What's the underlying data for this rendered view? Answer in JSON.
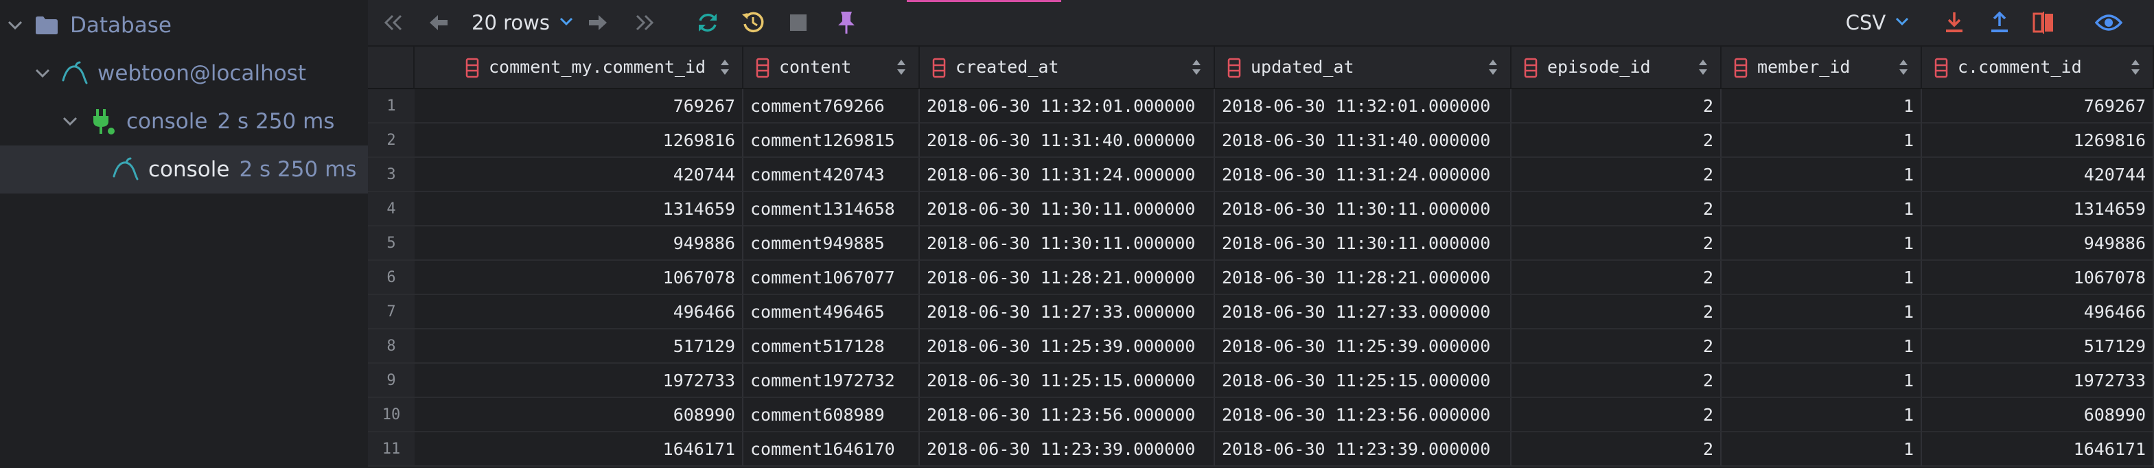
{
  "sidebar": {
    "items": [
      {
        "label": "Database",
        "timing": ""
      },
      {
        "label": "webtoon@localhost",
        "timing": ""
      },
      {
        "label": "console",
        "timing": "2 s 250 ms"
      },
      {
        "label": "console",
        "timing": "2 s 250 ms"
      }
    ]
  },
  "toolbar": {
    "rows_label": "20 rows",
    "export_format": "CSV"
  },
  "colors": {
    "accent": "#d94ea6",
    "refresh": "#1fa7a0",
    "pin": "#b87ee0",
    "export": "#e2584a",
    "import": "#4d8ff0",
    "compare": "#e2584a",
    "eye": "#4d8ff0",
    "column_icon": "#e0525e",
    "mysql_icon": "#3aa7b5",
    "plug_icon": "#3fb950"
  },
  "icons": {
    "first_page": "double-chevron-left-icon",
    "prev_page": "arrow-left-icon",
    "next_page": "arrow-right-icon",
    "last_page": "double-chevron-right-icon",
    "refresh": "refresh-icon",
    "history": "history-icon",
    "stop": "stop-icon",
    "pin": "pin-icon",
    "export": "download-icon",
    "import": "upload-icon",
    "compare": "compare-icon",
    "view": "eye-icon"
  },
  "table": {
    "columns": [
      "comment_my.comment_id",
      "content",
      "created_at",
      "updated_at",
      "episode_id",
      "member_id",
      "c.comment_id"
    ],
    "row_numbers": [
      "1",
      "2",
      "3",
      "4",
      "5",
      "6",
      "7",
      "8",
      "9",
      "10",
      "11"
    ],
    "rows": [
      [
        "769267",
        "comment769266",
        "2018-06-30 11:32:01.000000",
        "2018-06-30 11:32:01.000000",
        "2",
        "1",
        "769267"
      ],
      [
        "1269816",
        "comment1269815",
        "2018-06-30 11:31:40.000000",
        "2018-06-30 11:31:40.000000",
        "2",
        "1",
        "1269816"
      ],
      [
        "420744",
        "comment420743",
        "2018-06-30 11:31:24.000000",
        "2018-06-30 11:31:24.000000",
        "2",
        "1",
        "420744"
      ],
      [
        "1314659",
        "comment1314658",
        "2018-06-30 11:30:11.000000",
        "2018-06-30 11:30:11.000000",
        "2",
        "1",
        "1314659"
      ],
      [
        "949886",
        "comment949885",
        "2018-06-30 11:30:11.000000",
        "2018-06-30 11:30:11.000000",
        "2",
        "1",
        "949886"
      ],
      [
        "1067078",
        "comment1067077",
        "2018-06-30 11:28:21.000000",
        "2018-06-30 11:28:21.000000",
        "2",
        "1",
        "1067078"
      ],
      [
        "496466",
        "comment496465",
        "2018-06-30 11:27:33.000000",
        "2018-06-30 11:27:33.000000",
        "2",
        "1",
        "496466"
      ],
      [
        "517129",
        "comment517128",
        "2018-06-30 11:25:39.000000",
        "2018-06-30 11:25:39.000000",
        "2",
        "1",
        "517129"
      ],
      [
        "1972733",
        "comment1972732",
        "2018-06-30 11:25:15.000000",
        "2018-06-30 11:25:15.000000",
        "2",
        "1",
        "1972733"
      ],
      [
        "608990",
        "comment608989",
        "2018-06-30 11:23:56.000000",
        "2018-06-30 11:23:56.000000",
        "2",
        "1",
        "608990"
      ],
      [
        "1646171",
        "comment1646170",
        "2018-06-30 11:23:39.000000",
        "2018-06-30 11:23:39.000000",
        "2",
        "1",
        "1646171"
      ]
    ]
  }
}
